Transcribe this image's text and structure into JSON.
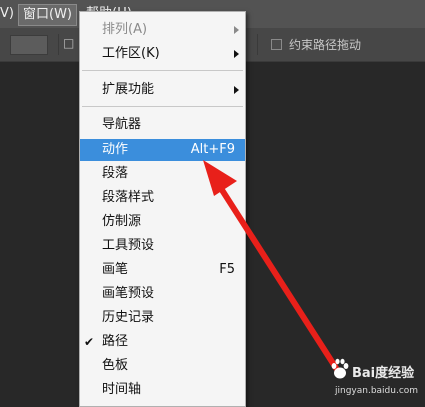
{
  "menubar": {
    "partial_left": "V)",
    "window_menu": "窗口(W)",
    "help_partial": "帮助(H)"
  },
  "options_bar": {
    "partial_label": "□",
    "constrain_path_label": "约束路径拖动"
  },
  "dropdown": {
    "items": [
      {
        "label": "排列(A)",
        "disabled": true,
        "submenu": true
      },
      {
        "label": "工作区(K)",
        "submenu": true
      },
      {
        "label": "扩展功能",
        "submenu": true
      },
      {
        "label": "导航器"
      },
      {
        "label": "动作",
        "shortcut": "Alt+F9",
        "highlighted": true
      },
      {
        "label": "段落"
      },
      {
        "label": "段落样式"
      },
      {
        "label": "仿制源"
      },
      {
        "label": "工具预设"
      },
      {
        "label": "画笔",
        "shortcut": "F5"
      },
      {
        "label": "画笔预设"
      },
      {
        "label": "历史记录"
      },
      {
        "label": "路径",
        "checked": true
      },
      {
        "label": "色板"
      },
      {
        "label": "时间轴"
      }
    ]
  },
  "watermark": {
    "brand": "Bai度经验",
    "url": "jingyan.baidu.com"
  },
  "colors": {
    "highlight": "#3b8edc",
    "annotation_arrow": "#e8201a"
  }
}
